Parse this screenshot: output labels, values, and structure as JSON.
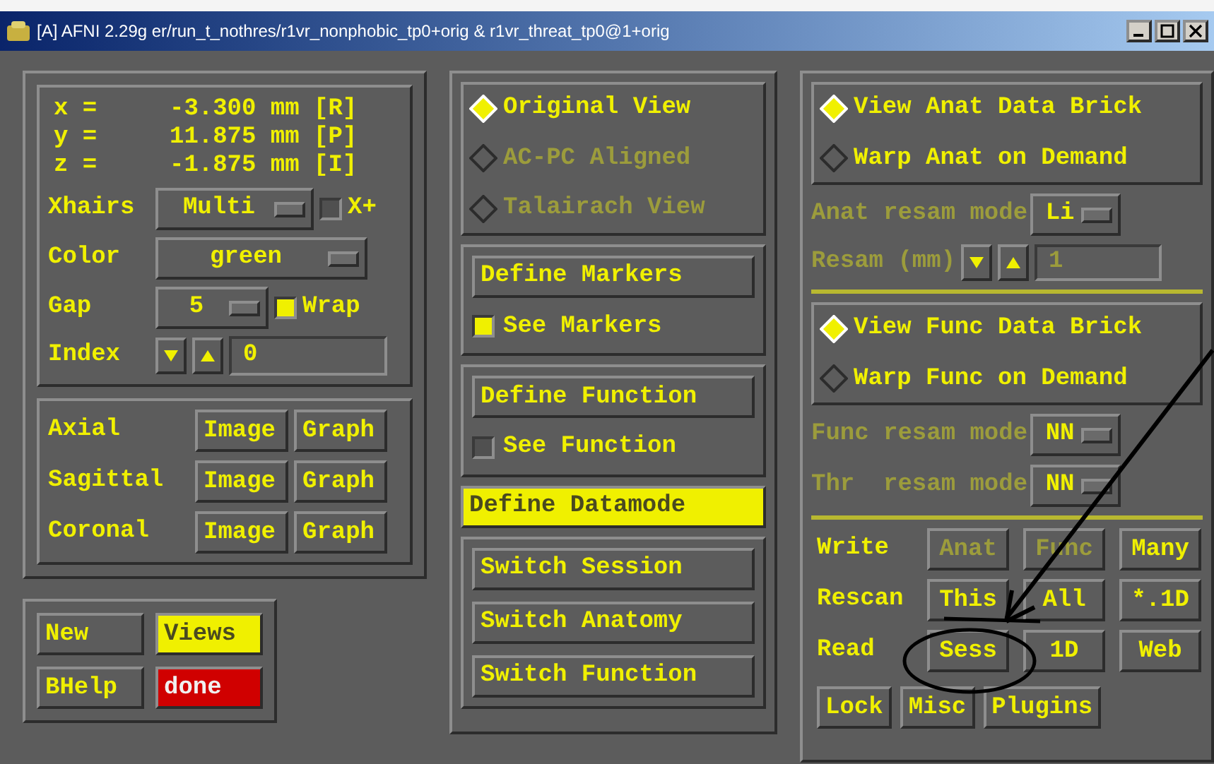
{
  "window": {
    "title": "[A] AFNI 2.29g er/run_t_nothres/r1vr_nonphobic_tp0+orig & r1vr_threat_tp0@1+orig"
  },
  "coords": [
    {
      "label": "x =",
      "value": "-3.300 mm [R]"
    },
    {
      "label": "y =",
      "value": "11.875 mm [P]"
    },
    {
      "label": "z =",
      "value": "-1.875 mm [I]"
    }
  ],
  "xhairs": {
    "label": "Xhairs",
    "value": "Multi",
    "toggle_label": "X+",
    "checked": false
  },
  "color": {
    "label": "Color",
    "value": "green"
  },
  "gap": {
    "label": "Gap",
    "value": "5",
    "toggle_label": "Wrap",
    "checked": true
  },
  "index": {
    "label": "Index",
    "value": "0"
  },
  "views": [
    {
      "label": "Axial",
      "buttons": [
        "Image",
        "Graph"
      ]
    },
    {
      "label": "Sagittal",
      "buttons": [
        "Image",
        "Graph"
      ]
    },
    {
      "label": "Coronal",
      "buttons": [
        "Image",
        "Graph"
      ]
    }
  ],
  "bottom_buttons": [
    {
      "label": "New",
      "kind": "normal"
    },
    {
      "label": "Views",
      "kind": "highlight"
    },
    {
      "label": "BHelp",
      "kind": "normal"
    },
    {
      "label": "done",
      "kind": "danger"
    }
  ],
  "view_modes": [
    {
      "label": "Original View",
      "selected": true,
      "disabled": false
    },
    {
      "label": "AC-PC Aligned",
      "selected": false,
      "disabled": true
    },
    {
      "label": "Talairach View",
      "selected": false,
      "disabled": true
    }
  ],
  "markers": {
    "button": "Define Markers",
    "toggle_label": "See Markers",
    "checked": true
  },
  "function": {
    "button": "Define Function",
    "toggle_label": "See Function",
    "checked": false
  },
  "datamode_button": "Define Datamode",
  "switch_buttons": [
    "Switch Session",
    "Switch Anatomy",
    "Switch Function"
  ],
  "anat": {
    "options": [
      {
        "label": "View Anat Data Brick",
        "selected": true
      },
      {
        "label": "Warp Anat on Demand",
        "selected": false
      }
    ],
    "resam_label": "Anat resam mode",
    "resam_value": "Li",
    "size_label": "Resam (mm)",
    "size_value": "1"
  },
  "func": {
    "options": [
      {
        "label": "View Func Data Brick",
        "selected": true
      },
      {
        "label": "Warp Func on Demand",
        "selected": false
      }
    ],
    "resam_rows": [
      {
        "label": "Func resam mode",
        "value": "NN"
      },
      {
        "label": "Thr  resam mode",
        "value": "NN"
      }
    ]
  },
  "file_rows": [
    {
      "label": "Write",
      "buttons": [
        {
          "label": "Anat",
          "disabled": true
        },
        {
          "label": "Func",
          "disabled": true
        },
        {
          "label": "Many",
          "disabled": false
        }
      ]
    },
    {
      "label": "Rescan",
      "buttons": [
        {
          "label": "This",
          "disabled": false
        },
        {
          "label": "All",
          "disabled": false
        },
        {
          "label": "*.1D",
          "disabled": false
        }
      ]
    },
    {
      "label": "Read",
      "buttons": [
        {
          "label": "Sess",
          "disabled": false
        },
        {
          "label": "1D",
          "disabled": false
        },
        {
          "label": "Web",
          "disabled": false
        }
      ]
    }
  ],
  "misc_buttons": [
    "Lock",
    "Misc",
    "Plugins"
  ]
}
